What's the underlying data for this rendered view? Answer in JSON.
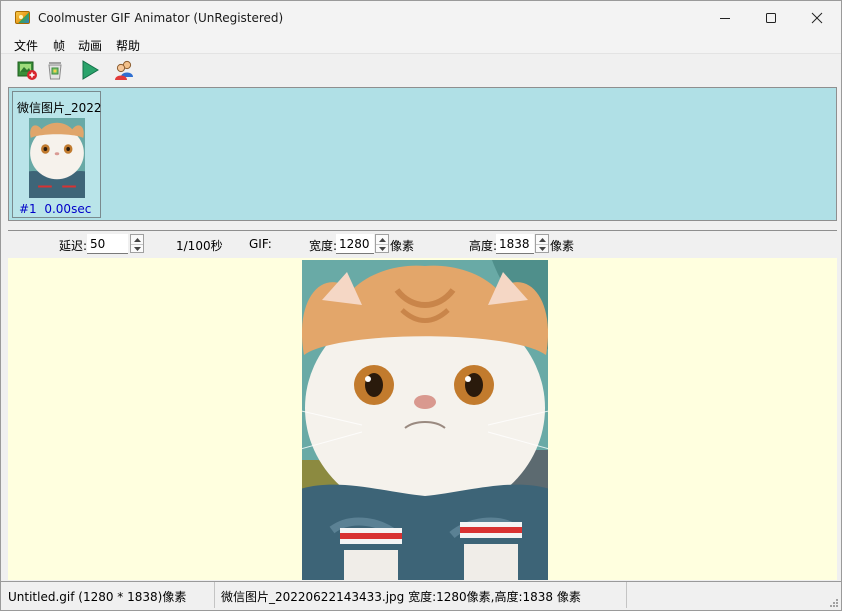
{
  "window": {
    "title": "Coolmuster GIF Animator (UnRegistered)",
    "controls": {
      "minimize": "minimize-icon",
      "maximize": "maximize-icon",
      "close": "close-icon"
    }
  },
  "menu": {
    "items": [
      {
        "label": "文件"
      },
      {
        "label": "帧"
      },
      {
        "label": "动画"
      },
      {
        "label": "帮助"
      }
    ]
  },
  "toolbar": {
    "buttons": [
      {
        "icon": "add-image-icon"
      },
      {
        "icon": "delete-frame-icon"
      },
      {
        "icon": "play-icon"
      },
      {
        "icon": "user-icon"
      }
    ]
  },
  "frames": [
    {
      "name": "微信图片_2022",
      "index": "#1",
      "duration": "0.00sec"
    }
  ],
  "settings": {
    "delay_label": "延迟:",
    "delay_value": "50",
    "delay_unit": "1/100秒",
    "gif_label": "GIF:",
    "width_label": "宽度:",
    "width_value": "1280",
    "width_unit": "像素",
    "height_label": "高度:",
    "height_value": "1838",
    "height_unit": "像素"
  },
  "status": {
    "file": "Untitled.gif (1280 * 1838)像素",
    "image_info": "微信图片_20220622143433.jpg 宽度:1280像素,高度:1838 像素",
    "extra": ""
  },
  "colors": {
    "frames_background": "#b0e0e6",
    "preview_background": "#ffffdf",
    "frame_info_text": "#0000c8"
  }
}
